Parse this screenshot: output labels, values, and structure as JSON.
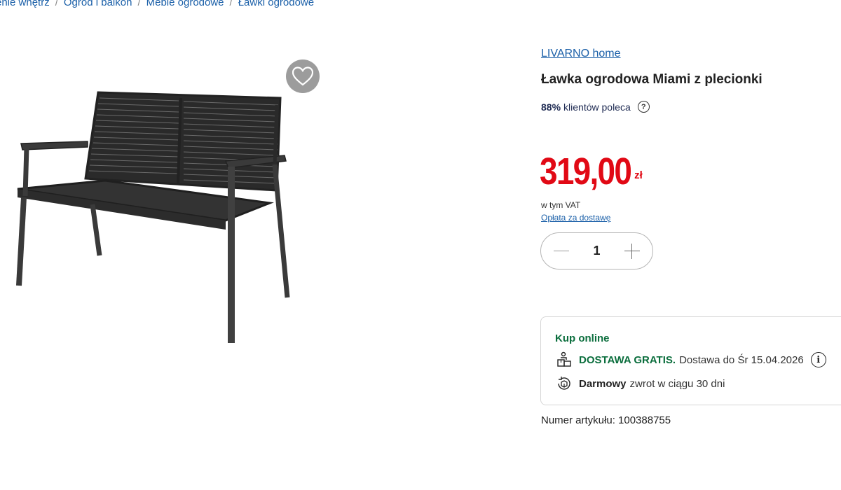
{
  "breadcrumb": {
    "items": [
      "enie wnętrz",
      "Ogród i balkon",
      "Meble ogrodowe",
      "Ławki ogrodowe"
    ],
    "separator": "/"
  },
  "product": {
    "brand": "LIVARNO home",
    "title": "Ławka ogrodowa Miami z plecionki",
    "recommend_percent": "88%",
    "recommend_text": "klientów poleca",
    "recommend_help": "?",
    "price_value": "319,00",
    "price_currency": "zł",
    "vat_text": "w tym VAT",
    "delivery_fee_link": "Opłata za dostawę",
    "quantity": "1",
    "article_number": "Numer artykułu: 100388755"
  },
  "buy_online": {
    "title": "Kup online",
    "delivery_strong": "DOSTAWA GRATIS.",
    "delivery_text": "Dostawa do Śr 15.04.2026",
    "info_icon": "i",
    "return_strong": "Darmowy",
    "return_text": "zwrot w ciągu 30 dni"
  },
  "icons": {
    "favorite": "heart-icon",
    "delivery": "delivery-box-icon",
    "return": "return-package-icon",
    "info": "info-icon",
    "help": "question-icon"
  },
  "colors": {
    "link": "#1a5fa8",
    "price": "#e10915",
    "green": "#0b6e3d"
  }
}
